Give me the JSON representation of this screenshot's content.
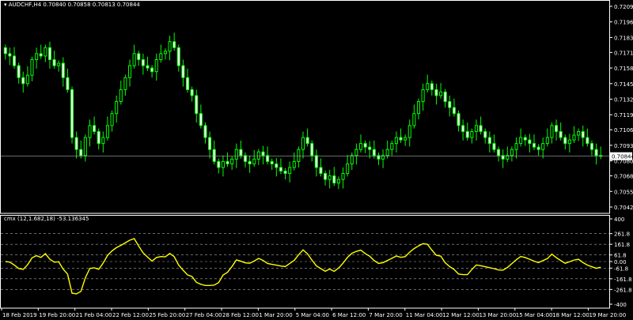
{
  "main_chart": {
    "symbol_header": "AUDCHF,H4  0.70840 0.70858 0.70813 0.70844",
    "price_ticks": [
      "0.72095",
      "0.71965",
      "0.71835",
      "0.71710",
      "0.71580",
      "0.71450",
      "0.71320",
      "0.71190",
      "0.71065",
      "0.70935",
      "0.70805",
      "0.70680",
      "0.70550",
      "0.70420"
    ],
    "current_price": "0.70844",
    "candle_color": "#00ff00",
    "background": "#000000"
  },
  "indicator": {
    "header": "cmx (12,1.682,18) -53.136345",
    "ticks": [
      "400",
      "261.8",
      "161.8",
      "61.8",
      "0.00",
      "-61.8",
      "-161.8",
      "-261.8",
      "-400"
    ],
    "line_color": "#ffff00",
    "level_line_color": "#aaaaaa"
  },
  "time_axis": [
    "18 Feb 2019",
    "19 Feb 20:00",
    "21 Feb 04:00",
    "22 Feb 12:00",
    "25 Feb 20:00",
    "27 Feb 04:00",
    "28 Feb 12:00",
    "1 Mar 20:00",
    "5 Mar 04:00",
    "6 Mar 12:00",
    "7 Mar 20:00",
    "11 Mar 04:00",
    "12 Mar 12:00",
    "13 Mar 20:00",
    "15 Mar 04:00",
    "18 Mar 12:00",
    "19 Mar 20:00"
  ],
  "chart_data": {
    "type": "candlestick",
    "series": [
      {
        "name": "AUDCHF,H4",
        "close": [
          0.717,
          0.7168,
          0.716,
          0.715,
          0.7145,
          0.7152,
          0.7165,
          0.717,
          0.7168,
          0.7175,
          0.7165,
          0.716,
          0.7162,
          0.715,
          0.714,
          0.71,
          0.709,
          0.7085,
          0.71,
          0.711,
          0.7105,
          0.7095,
          0.71,
          0.711,
          0.712,
          0.713,
          0.714,
          0.715,
          0.716,
          0.717,
          0.7165,
          0.716,
          0.7158,
          0.7155,
          0.7165,
          0.717,
          0.7172,
          0.718,
          0.7175,
          0.716,
          0.715,
          0.714,
          0.7135,
          0.712,
          0.711,
          0.71,
          0.709,
          0.708,
          0.7075,
          0.708,
          0.7078,
          0.7082,
          0.709,
          0.7085,
          0.708,
          0.7078,
          0.7082,
          0.7088,
          0.7085,
          0.708,
          0.7078,
          0.7075,
          0.7072,
          0.707,
          0.7075,
          0.708,
          0.709,
          0.71,
          0.7095,
          0.7085,
          0.7075,
          0.707,
          0.7065,
          0.7068,
          0.7062,
          0.7065,
          0.707,
          0.7078,
          0.7085,
          0.709,
          0.7095,
          0.7092,
          0.709,
          0.7085,
          0.7082,
          0.7085,
          0.709,
          0.7095,
          0.71,
          0.7098,
          0.71,
          0.711,
          0.712,
          0.713,
          0.714,
          0.7145,
          0.714,
          0.7135,
          0.7138,
          0.713,
          0.7125,
          0.712,
          0.711,
          0.7105,
          0.71,
          0.7105,
          0.711,
          0.7105,
          0.71,
          0.7095,
          0.709,
          0.7085,
          0.7082,
          0.7085,
          0.709,
          0.7095,
          0.71,
          0.7098,
          0.7095,
          0.7092,
          0.709,
          0.7095,
          0.71,
          0.711,
          0.7105,
          0.71,
          0.7095,
          0.7098,
          0.7102,
          0.7105,
          0.71,
          0.7095,
          0.709,
          0.7085,
          0.70844
        ]
      }
    ],
    "y_range": [
      0.7042,
      0.72095
    ],
    "indicator_range": [
      -400,
      400
    ],
    "current_price": 0.70844,
    "last_values": {
      "open": 0.7084,
      "high": 0.70858,
      "low": 0.70813,
      "close": 0.70844
    },
    "indicator": {
      "name": "cmx (12,1.682,18)",
      "last_value": -53.136345
    }
  }
}
